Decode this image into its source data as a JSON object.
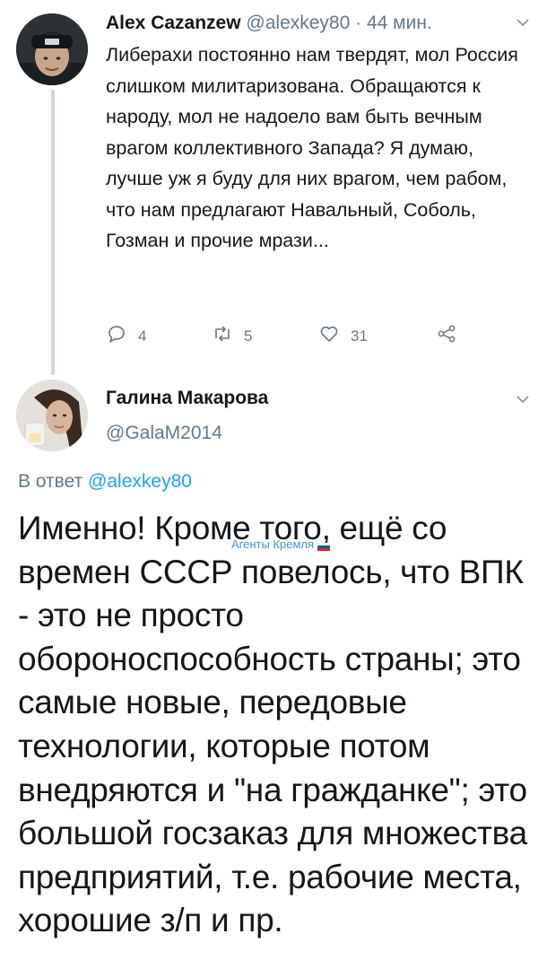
{
  "reply_context": {
    "author_name": "Alex Cazanzew",
    "handle": "@alexkey80",
    "separator": "·",
    "time": "44 мин.",
    "text": "Либерахи постоянно нам твердят, мол Россия слишком милитаризована. Обращаются к народу, мол не надоело вам быть вечным врагом коллективного Запада? Я думаю, лучше уж я буду для них врагом, чем рабом, что нам предлагают Навальный, Соболь, Гозман и прочие мрази...",
    "actions": {
      "reply_count": "4",
      "retweet_count": "5",
      "like_count": "31"
    }
  },
  "main_tweet": {
    "author_name": "Галина Макарова",
    "handle": "@GalaM2014",
    "reply_prefix": "В ответ ",
    "reply_mention": "@alexkey80",
    "text": "Именно! Кроме того, ещё со времен СССР повелось, что ВПК - это не просто обороноспособность страны; это самые новые, передовые технологии, которые потом внедряются и \"на гражданке\"; это большой госзаказ  для множества предприятий, т.е. рабочие места, хорошие з/п и пр."
  },
  "watermark": {
    "text": "Агенты Кремля"
  },
  "colors": {
    "text": "#14171a",
    "secondary": "#657786",
    "link": "#1da1f2",
    "thread_line": "#ccd6dd"
  },
  "icons": {
    "reply": "reply-icon",
    "retweet": "retweet-icon",
    "like": "like-icon",
    "share": "share-icon",
    "caret": "chevron-down-icon"
  }
}
